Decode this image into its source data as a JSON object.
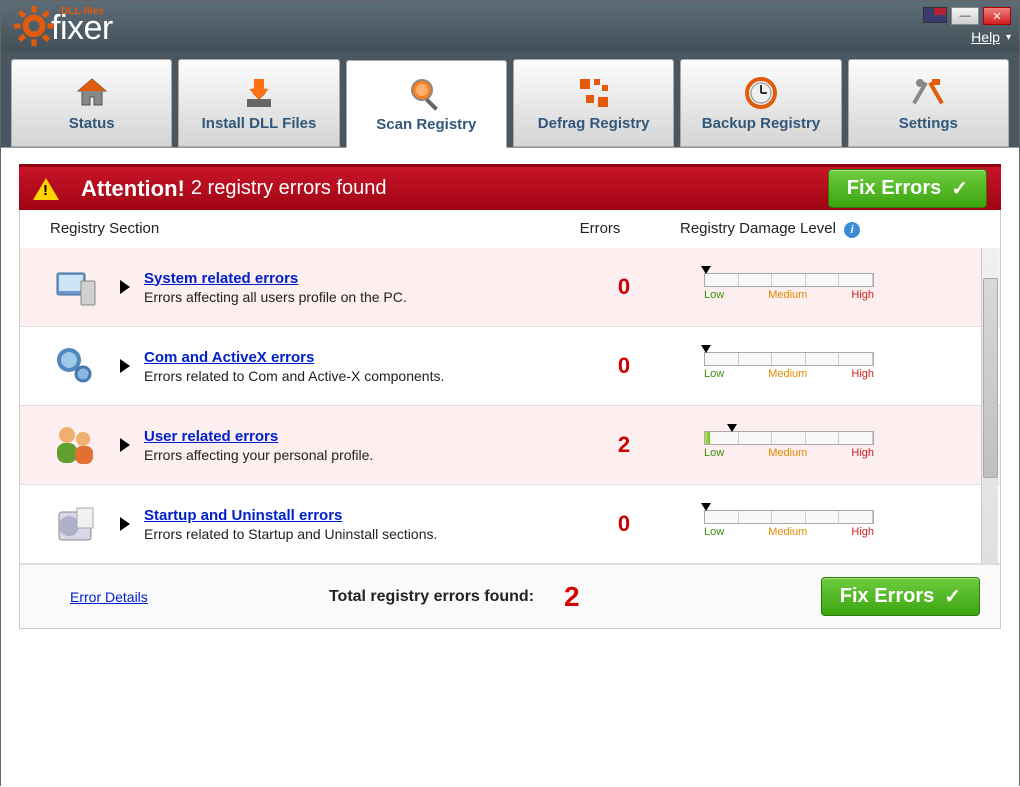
{
  "window": {
    "brand_small": "DLL-files",
    "brand_main": "fixer",
    "help_label": "Help",
    "help_arrow": "▾"
  },
  "tabs": [
    {
      "label": "Status",
      "icon": "home"
    },
    {
      "label": "Install DLL Files",
      "icon": "download"
    },
    {
      "label": "Scan Registry",
      "icon": "magnify",
      "active": true
    },
    {
      "label": "Defrag Registry",
      "icon": "blocks"
    },
    {
      "label": "Backup Registry",
      "icon": "clock"
    },
    {
      "label": "Settings",
      "icon": "tools"
    }
  ],
  "alert": {
    "strong": "Attention!",
    "message": "2 registry errors found",
    "fix_label": "Fix Errors"
  },
  "table": {
    "col_section": "Registry Section",
    "col_errors": "Errors",
    "col_damage": "Registry Damage Level"
  },
  "rows": [
    {
      "title": "System related errors",
      "desc": "Errors affecting all users profile on the PC.",
      "errors": 0,
      "damage_pct": 0,
      "highlight": true,
      "icon": "system"
    },
    {
      "title": "Com and ActiveX errors",
      "desc": "Errors related to Com and Active-X components.",
      "errors": 0,
      "damage_pct": 0,
      "highlight": false,
      "icon": "gear"
    },
    {
      "title": "User related errors",
      "desc": "Errors affecting your personal profile.",
      "errors": 2,
      "damage_pct": 15,
      "highlight": true,
      "icon": "users"
    },
    {
      "title": "Startup and Uninstall errors",
      "desc": "Errors related to Startup and Uninstall sections.",
      "errors": 0,
      "damage_pct": 0,
      "highlight": false,
      "icon": "box"
    }
  ],
  "gauge_labels": {
    "low": "Low",
    "medium": "Medium",
    "high": "High"
  },
  "footer": {
    "error_details": "Error Details",
    "total_label": "Total registry errors found:",
    "total_count": 2,
    "fix_label": "Fix Errors"
  }
}
